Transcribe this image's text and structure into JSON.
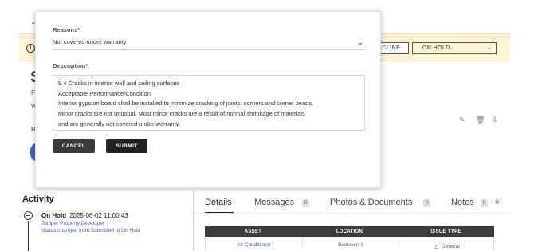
{
  "page": {
    "back_icon": "←",
    "alert": {
      "icon": "!",
      "decline_label": "DECLINE",
      "status_select": "ON HOLD",
      "status_chevron": "⌄"
    },
    "peek": {
      "s": "S",
      "f": "F",
      "w": "W",
      "r": "R"
    },
    "row_icons": {
      "edit": "✎",
      "delete": "🗑",
      "download": "⇩"
    }
  },
  "activity": {
    "title": "Activity",
    "entry": {
      "status": "On Hold",
      "timestamp": "2025-06-02 11:00:43",
      "actor": "Juniper Property Developer",
      "note": "Status changed from Submitted to On Hold"
    }
  },
  "tabs": {
    "items": [
      {
        "label": "Details"
      },
      {
        "label": "Messages",
        "count": "0"
      },
      {
        "label": "Photos & Documents",
        "count": "0"
      },
      {
        "label": "Notes",
        "count": "0"
      }
    ],
    "more": "»"
  },
  "table": {
    "headers": [
      "ASSET",
      "LOCATION",
      "ISSUE TYPE"
    ],
    "row": [
      "Air Conditioner",
      "Bedroom 1",
      "General"
    ]
  },
  "modal": {
    "reasons_label": "Reasons",
    "required_mark": "*",
    "reason_value": "Not covered under warranty",
    "reason_chevron": "⌄",
    "description_label": "Description",
    "description_lines": [
      "9.4 Cracks in interior wall and ceiling surfaces",
      "Acceptable Performance/Condition",
      "Interior gypsum board shall be installed to minimize cracking of joints, corners and corner beads.",
      "Minor cracks are not unusual. Most minor cracks are a result of normal shrinkage of materials",
      "and are generally not covered under warranty."
    ],
    "cancel_label": "CANCEL",
    "submit_label": "SUBMIT"
  },
  "colors": {
    "alert_bg": "#fcf3d2",
    "link_blue": "#4a63a9",
    "button_dark": "#222222",
    "required_red": "#c03030"
  }
}
